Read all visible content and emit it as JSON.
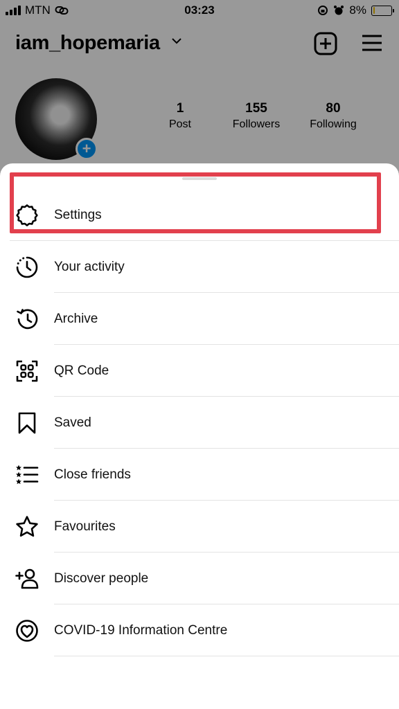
{
  "status_bar": {
    "carrier": "MTN",
    "time": "03:23",
    "battery": "8%",
    "battery_level": 0.08
  },
  "profile": {
    "username": "iam_hopemaria",
    "stats": [
      {
        "value": "1",
        "label": "Post"
      },
      {
        "value": "155",
        "label": "Followers"
      },
      {
        "value": "80",
        "label": "Following"
      }
    ]
  },
  "menu": {
    "items": [
      {
        "label": "Settings",
        "icon": "gear-icon"
      },
      {
        "label": "Your activity",
        "icon": "activity-icon"
      },
      {
        "label": "Archive",
        "icon": "archive-icon"
      },
      {
        "label": "QR Code",
        "icon": "qr-code-icon"
      },
      {
        "label": "Saved",
        "icon": "bookmark-icon"
      },
      {
        "label": "Close friends",
        "icon": "close-friends-icon"
      },
      {
        "label": "Favourites",
        "icon": "star-icon"
      },
      {
        "label": "Discover people",
        "icon": "add-person-icon"
      },
      {
        "label": "COVID-19 Information Centre",
        "icon": "covid-info-icon"
      }
    ]
  },
  "colors": {
    "highlight": "#e2404d",
    "accent": "#0095f6",
    "battery_low": "#f2c200"
  }
}
